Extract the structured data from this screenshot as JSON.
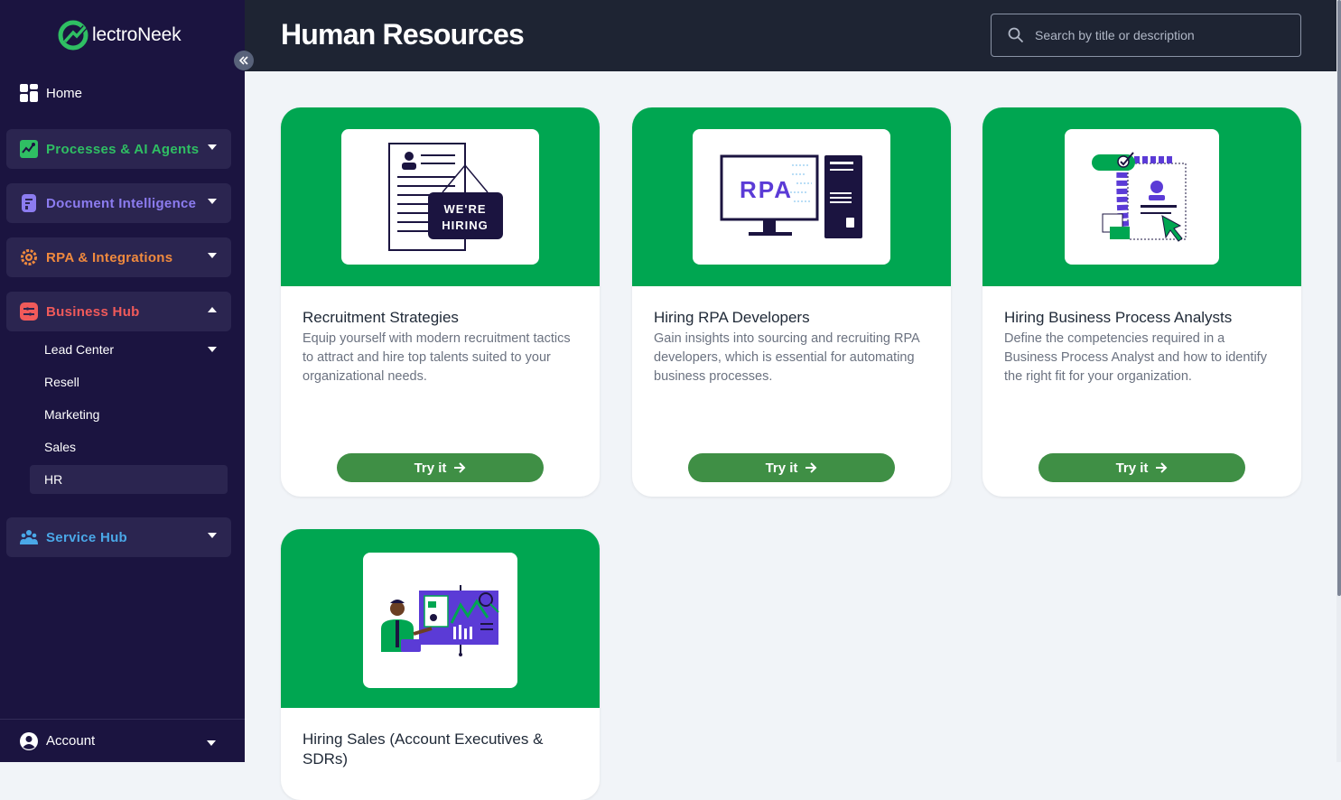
{
  "app": {
    "logo_text": "lectroNeek"
  },
  "sidebar": {
    "home_label": "Home",
    "groups": [
      {
        "label": "Processes & AI Agents",
        "color": "#2fbf63",
        "icon": "processes-icon"
      },
      {
        "label": "Document Intelligence",
        "color": "#8c7cf0",
        "icon": "document-icon"
      },
      {
        "label": "RPA & Integrations",
        "color": "#f08a3e",
        "icon": "gear-icon"
      },
      {
        "label": "Business Hub",
        "color": "#f05a5a",
        "icon": "business-icon"
      },
      {
        "label": "Service Hub",
        "color": "#4aa8e8",
        "icon": "people-icon"
      }
    ],
    "business_hub_items": [
      "Lead Center",
      "Resell",
      "Marketing",
      "Sales",
      "HR"
    ],
    "account_label": "Account"
  },
  "header": {
    "title": "Human Resources",
    "search_placeholder": "Search by title or description"
  },
  "cards": [
    {
      "title": "Recruitment Strategies",
      "description": "Equip yourself with modern recruitment tactics to attract and hire top talents suited to your organizational needs.",
      "button": "Try it",
      "image_text_1": "WE'RE",
      "image_text_2": "HIRING"
    },
    {
      "title": "Hiring RPA Developers",
      "description": "Gain insights into sourcing and recruiting RPA developers, which is essential for automating business processes.",
      "button": "Try it",
      "image_text_1": "RPA"
    },
    {
      "title": "Hiring Business Process Analysts",
      "description": "Define the competencies required in a Business Process Analyst and how to identify the right fit for your organization.",
      "button": "Try it"
    },
    {
      "title": "Hiring Sales (Account Executives & SDRs)"
    }
  ],
  "colors": {
    "brand_green": "#00a651",
    "button_green": "#3f8f45",
    "sidebar_bg": "#1b1440",
    "topbar_bg": "#1e2433"
  }
}
